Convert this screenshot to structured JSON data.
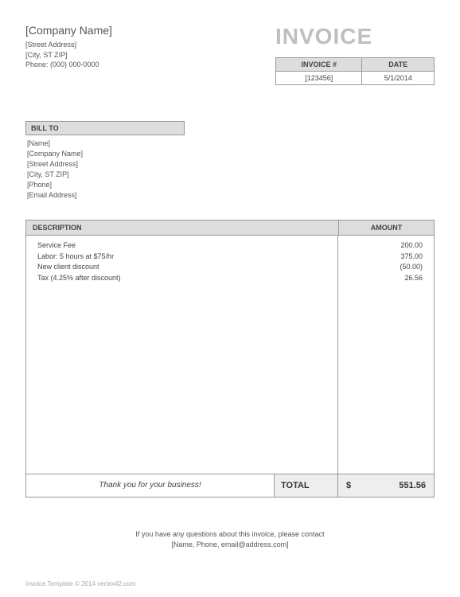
{
  "company": {
    "name": "[Company Name]",
    "street": "[Street Address]",
    "city": "[City, ST  ZIP]",
    "phone": "Phone: (000) 000-0000"
  },
  "title": "INVOICE",
  "meta": {
    "invoice_label": "INVOICE #",
    "date_label": "DATE",
    "invoice_number": "[123456]",
    "date": "5/1/2014"
  },
  "billto": {
    "header": "BILL TO",
    "name": "[Name]",
    "company": "[Company Name]",
    "street": "[Street Address]",
    "city": "[City, ST  ZIP]",
    "phone": "[Phone]",
    "email": "[Email Address]"
  },
  "columns": {
    "description": "DESCRIPTION",
    "amount": "AMOUNT"
  },
  "items": [
    {
      "desc": "Service Fee",
      "amount": "200.00"
    },
    {
      "desc": "Labor: 5 hours at $75/hr",
      "amount": "375.00"
    },
    {
      "desc": "New client discount",
      "amount": "(50.00)"
    },
    {
      "desc": "Tax (4.25% after discount)",
      "amount": "26.56"
    }
  ],
  "thank_you": "Thank you for your business!",
  "total": {
    "label": "TOTAL",
    "currency": "$",
    "amount": "551.56"
  },
  "footer": {
    "line1": "If you have any questions about this invoice, please contact",
    "line2": "[Name, Phone, email@address.com]"
  },
  "copyright": "Invoice Template © 2014 vertex42.com"
}
